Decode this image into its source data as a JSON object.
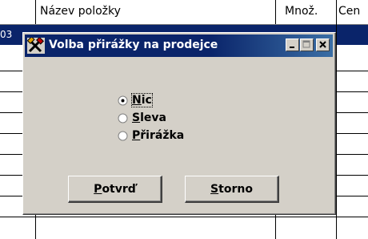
{
  "table": {
    "col_name": "Název položky",
    "col_qty": "Množ.",
    "col_price": "Cen",
    "selected_row_fragment": "03"
  },
  "dialog": {
    "title": "Volba přirážky na prodejce",
    "options": [
      {
        "label_first": "N",
        "label_rest": "ic",
        "selected": true
      },
      {
        "label_first": "S",
        "label_rest": "leva",
        "selected": false
      },
      {
        "label_first": "P",
        "label_rest": "řirážka",
        "selected": false
      }
    ],
    "confirm": {
      "first": "P",
      "rest": "otvrď"
    },
    "cancel": {
      "first": "S",
      "rest": "torno"
    }
  },
  "colors": {
    "titlebar": "#0a246a",
    "dialog_face": "#d4d0c8",
    "selection": "#0a246a"
  }
}
